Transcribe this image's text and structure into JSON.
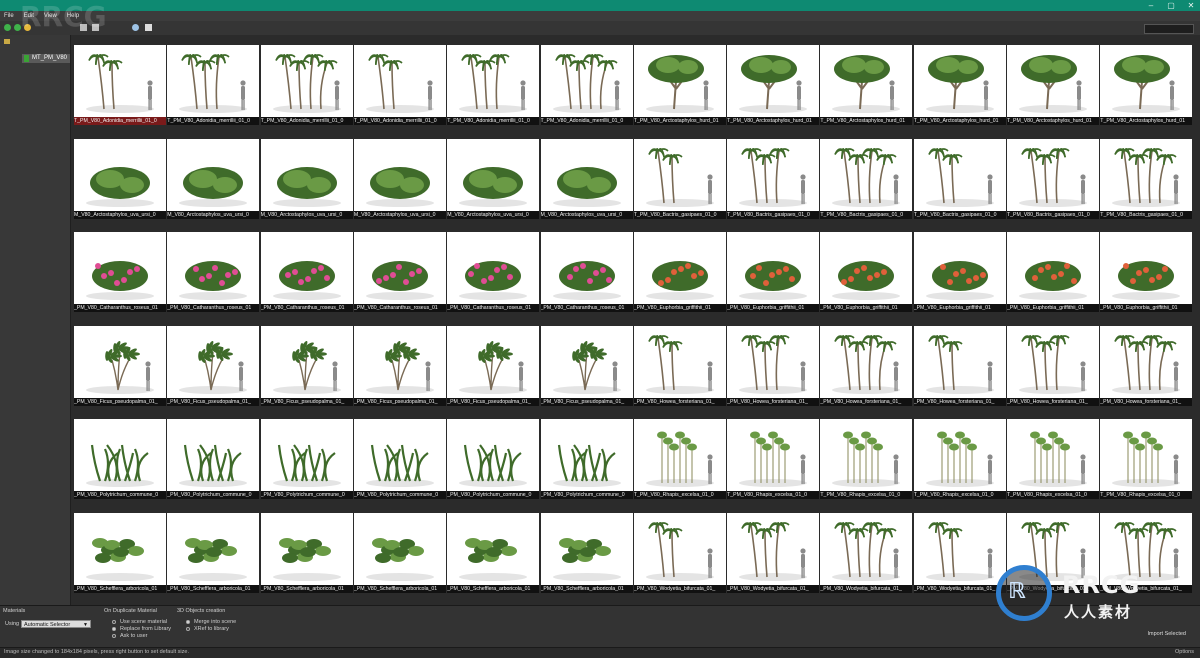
{
  "menu": [
    "File",
    "Edit",
    "View",
    "Help"
  ],
  "window_controls": [
    "–",
    "▢",
    "✕"
  ],
  "sidebar": {
    "root_label": "",
    "selected_item": "MT_PM_V80"
  },
  "watermark": "RRCG",
  "logo": {
    "brand": "RRCG",
    "subtitle": "人人素材"
  },
  "bottom": {
    "materials_title": "Materials",
    "using_label": "Using",
    "using_value": "Automatic Selector",
    "duplicate_title": "On Duplicate Material",
    "duplicate_options": [
      "Use scene material",
      "Replace from Library",
      "Ask to user"
    ],
    "duplicate_selected": 1,
    "objects_title": "3D Objects creation",
    "objects_options": [
      "Merge into scene",
      "XRef to library"
    ],
    "objects_selected": 0,
    "import_button": "Import Selected"
  },
  "status": {
    "message": "Image size changed to 184x184 pixels, press right button to set default size.",
    "options": "Options"
  },
  "grid": {
    "columns": 12,
    "rows": [
      {
        "kind": "palm",
        "captions": [
          "T_PM_V80_Adonidia_merrillii_01_0",
          "T_PM_V80_Adonidia_merrillii_01_0",
          "T_PM_V80_Adonidia_merrillii_01_0",
          "T_PM_V80_Adonidia_merrillii_01_0",
          "T_PM_V80_Adonidia_merrillii_01_0",
          "T_PM_V80_Adonidia_merrillii_01_0",
          "T_PM_V80_Arctostaphylos_hurd_01",
          "T_PM_V80_Arctostaphylos_hurd_01",
          "T_PM_V80_Arctostaphylos_hurd_01",
          "T_PM_V80_Arctostaphylos_hurd_01",
          "T_PM_V80_Arctostaphylos_hurd_01",
          "T_PM_V80_Arctostaphylos_hurd_01"
        ]
      },
      {
        "kind": "shrub",
        "captions": [
          "M_V80_Arctostaphylos_uva_ursi_0",
          "M_V80_Arctostaphylos_uva_ursi_0",
          "M_V80_Arctostaphylos_uva_ursi_0",
          "M_V80_Arctostaphylos_uva_ursi_0",
          "M_V80_Arctostaphylos_uva_ursi_0",
          "M_V80_Arctostaphylos_uva_ursi_0",
          "T_PM_V80_Bactris_gasipaes_01_0",
          "T_PM_V80_Bactris_gasipaes_01_0",
          "T_PM_V80_Bactris_gasipaes_01_0",
          "T_PM_V80_Bactris_gasipaes_01_0",
          "T_PM_V80_Bactris_gasipaes_01_0",
          "T_PM_V80_Bactris_gasipaes_01_0"
        ]
      },
      {
        "kind": "flower",
        "captions": [
          "_PM_V80_Catharanthus_roseus_01",
          "_PM_V80_Catharanthus_roseus_01",
          "_PM_V80_Catharanthus_roseus_01",
          "_PM_V80_Catharanthus_roseus_01",
          "_PM_V80_Catharanthus_roseus_01",
          "_PM_V80_Catharanthus_roseus_01",
          "_PM_V80_Euphorbia_griffithii_01",
          "_PM_V80_Euphorbia_griffithii_01",
          "_PM_V80_Euphorbia_griffithii_01",
          "_PM_V80_Euphorbia_griffithii_01",
          "_PM_V80_Euphorbia_griffithii_01",
          "_PM_V80_Euphorbia_griffithii_01"
        ]
      },
      {
        "kind": "ficus",
        "captions": [
          "_PM_V80_Ficus_pseudopalma_01_",
          "_PM_V80_Ficus_pseudopalma_01_",
          "_PM_V80_Ficus_pseudopalma_01_",
          "_PM_V80_Ficus_pseudopalma_01_",
          "_PM_V80_Ficus_pseudopalma_01_",
          "_PM_V80_Ficus_pseudopalma_01_",
          "_PM_V80_Howea_forsteriana_01_",
          "_PM_V80_Howea_forsteriana_01_",
          "_PM_V80_Howea_forsteriana_01_",
          "_PM_V80_Howea_forsteriana_01_",
          "_PM_V80_Howea_forsteriana_01_",
          "_PM_V80_Howea_forsteriana_01_"
        ]
      },
      {
        "kind": "fern",
        "captions": [
          "_PM_V80_Polytrichum_commune_0",
          "_PM_V80_Polytrichum_commune_0",
          "_PM_V80_Polytrichum_commune_0",
          "_PM_V80_Polytrichum_commune_0",
          "_PM_V80_Polytrichum_commune_0",
          "_PM_V80_Polytrichum_commune_0",
          "T_PM_V80_Rhapis_excelsa_01_0",
          "T_PM_V80_Rhapis_excelsa_01_0",
          "T_PM_V80_Rhapis_excelsa_01_0",
          "T_PM_V80_Rhapis_excelsa_01_0",
          "T_PM_V80_Rhapis_excelsa_01_0",
          "T_PM_V80_Rhapis_excelsa_01_0"
        ]
      },
      {
        "kind": "leafy",
        "captions": [
          "_PM_V80_Schefflera_arboricola_01",
          "_PM_V80_Schefflera_arboricola_01",
          "_PM_V80_Schefflera_arboricola_01",
          "_PM_V80_Schefflera_arboricola_01",
          "_PM_V80_Schefflera_arboricola_01",
          "_PM_V80_Schefflera_arboricola_01",
          "_PM_V80_Wodyetia_bifurcata_01_",
          "_PM_V80_Wodyetia_bifurcata_01_",
          "_PM_V80_Wodyetia_bifurcata_01_",
          "_PM_V80_Wodyetia_bifurcata_01_",
          "_PM_V80_Wodyetia_bifurcata_01_",
          "_PM_V80_Wodyetia_bifurcata_01_"
        ]
      }
    ],
    "right_kinds": [
      "tree",
      "palm",
      "flower",
      "palm",
      "bamboo",
      "palm"
    ],
    "selected_cell": [
      0,
      0
    ],
    "colors": {
      "leaf": "#3f6b2a",
      "leaf_light": "#6a9a45",
      "trunk": "#7a6a55",
      "pink": "#e04d94",
      "orange": "#e0603a",
      "silhouette": "#8a8a8a"
    }
  }
}
